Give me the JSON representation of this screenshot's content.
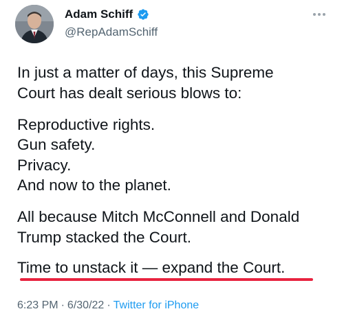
{
  "author": {
    "name": "Adam Schiff",
    "handle": "@RepAdamSchiff",
    "verified": true,
    "icons": {
      "avatar": "profile-photo",
      "verified": "verified-badge-icon",
      "more": "more-options-icon"
    }
  },
  "tweet": {
    "lines": [
      "In just a matter of days, this Supreme",
      "Court has dealt serious blows to:",
      "Reproductive rights.",
      "Gun safety.",
      "Privacy.",
      "And now to the planet.",
      "All because Mitch McConnell and Donald",
      "Trump stacked the Court.",
      "Time to unstack it — expand the Court."
    ],
    "time": "6:23 PM",
    "date": "6/30/22",
    "separator": "·",
    "source": "Twitter for iPhone"
  },
  "colors": {
    "accent": "#1d9bf0",
    "underline": "#e8233f",
    "secondary_text": "#536471",
    "primary_text": "#0f1419"
  }
}
